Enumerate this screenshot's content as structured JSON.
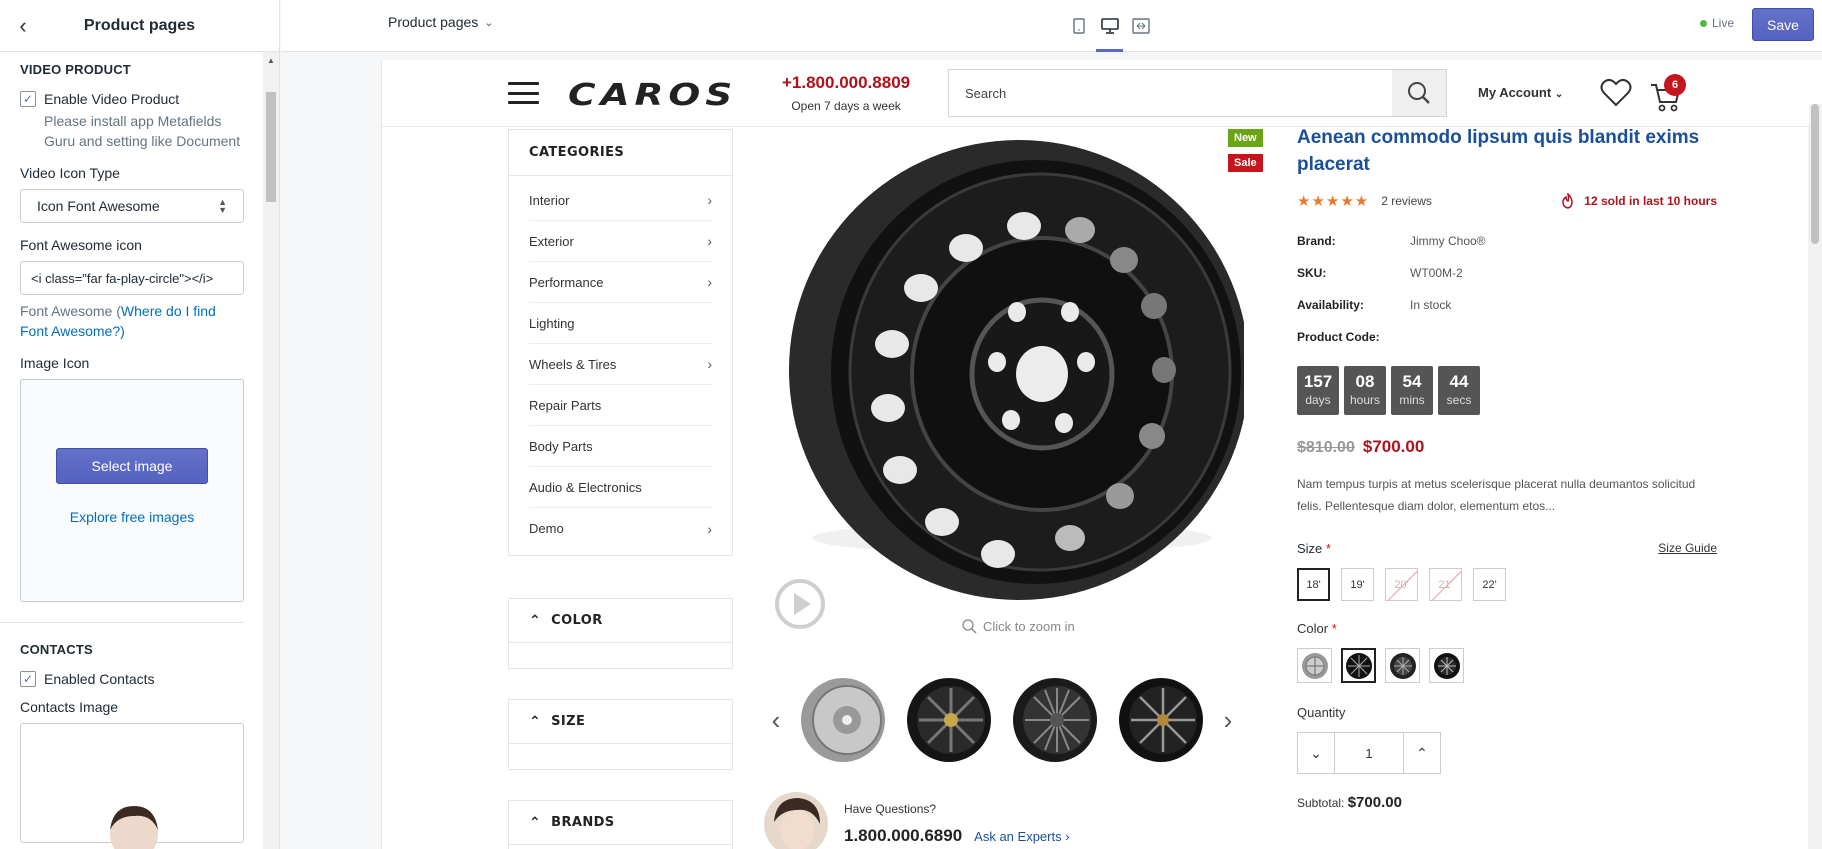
{
  "sidebar": {
    "title": "Product pages",
    "video_section_title": "VIDEO PRODUCT",
    "enable_video_label": "Enable Video Product",
    "enable_video_checked": true,
    "install_help": "Please install app Metafields Guru and setting like Document",
    "video_icon_type_label": "Video Icon Type",
    "video_icon_type_value": "Icon Font Awesome",
    "font_awesome_label": "Font Awesome icon",
    "font_awesome_value": "<i class=\"far fa-play-circle\"></i>",
    "font_awesome_help_prefix": "Font Awesome (",
    "font_awesome_help_link": "Where do I find Font Awesome?)",
    "image_icon_label": "Image Icon",
    "select_image_label": "Select image",
    "explore_images_label": "Explore free images",
    "contacts_section_title": "CONTACTS",
    "enable_contacts_label": "Enabled Contacts",
    "enable_contacts_checked": true,
    "contacts_image_label": "Contacts Image"
  },
  "topbar": {
    "page_select_label": "Product pages",
    "live_label": "Live",
    "save_label": "Save",
    "device_active": "desktop"
  },
  "store": {
    "logo_text": "CAROS",
    "phone": "+1.800.000.8809",
    "phone_hours": "Open 7 days a week",
    "search_placeholder": "Search",
    "account_label": "My Account",
    "cart_count": "6"
  },
  "categories": {
    "title": "CATEGORIES",
    "items": [
      {
        "label": "Interior",
        "has_sub": true
      },
      {
        "label": "Exterior",
        "has_sub": true
      },
      {
        "label": "Performance",
        "has_sub": true
      },
      {
        "label": "Lighting",
        "has_sub": false
      },
      {
        "label": "Wheels & Tires",
        "has_sub": true
      },
      {
        "label": "Repair Parts",
        "has_sub": false
      },
      {
        "label": "Body Parts",
        "has_sub": false
      },
      {
        "label": "Audio & Electronics",
        "has_sub": false
      },
      {
        "label": "Demo",
        "has_sub": true
      }
    ]
  },
  "filters": {
    "color": "COLOR",
    "size": "SIZE",
    "brands": "BRANDS"
  },
  "gallery": {
    "zoom_hint": "Click to zoom in",
    "badge_new": "New",
    "badge_sale": "Sale"
  },
  "help": {
    "question": "Have Questions?",
    "phone": "1.800.000.6890",
    "experts_link": "Ask an Experts"
  },
  "product": {
    "title": "Aenean commodo lipsum quis blandit exims placerat",
    "reviews": "2 reviews",
    "sold_text": "12 sold in last 10 hours",
    "brand_label": "Brand:",
    "brand_value": "Jimmy Choo®",
    "sku_label": "SKU:",
    "sku_value": "WT00M-2",
    "availability_label": "Availability:",
    "availability_value": "In stock",
    "code_label": "Product Code:",
    "countdown": [
      {
        "n": "157",
        "u": "days"
      },
      {
        "n": "08",
        "u": "hours"
      },
      {
        "n": "54",
        "u": "mins"
      },
      {
        "n": "44",
        "u": "secs"
      }
    ],
    "old_price": "$810.00",
    "new_price": "$700.00",
    "description": "Nam tempus turpis at metus scelerisque placerat nulla deumantos solicitud felis. Pellentesque diam dolor, elementum etos...",
    "size_label": "Size",
    "size_guide": "Size Guide",
    "sizes": [
      "18'",
      "19'",
      "20'",
      "21'",
      "22'"
    ],
    "color_label": "Color",
    "quantity_label": "Quantity",
    "quantity_value": "1",
    "subtotal_label": "Subtotal:",
    "subtotal_value": "$700.00"
  },
  "colors": {
    "accent": "#5c6ac4",
    "store_red": "#b0121c",
    "link_blue": "#1a4f9c",
    "badge_new": "#6aa516",
    "badge_sale": "#c4161c"
  }
}
